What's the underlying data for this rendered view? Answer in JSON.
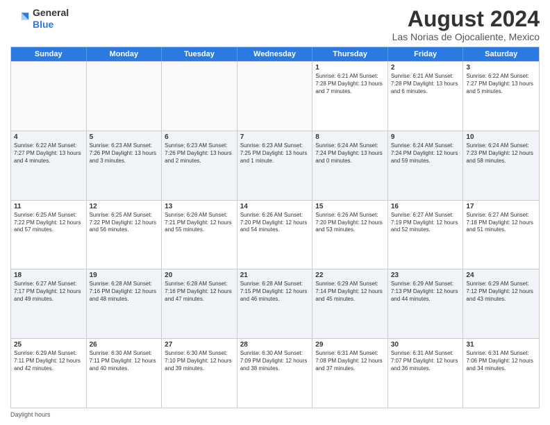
{
  "logo": {
    "line1": "General",
    "line2": "Blue"
  },
  "title": "August 2024",
  "subtitle": "Las Norias de Ojocaliente, Mexico",
  "days": [
    "Sunday",
    "Monday",
    "Tuesday",
    "Wednesday",
    "Thursday",
    "Friday",
    "Saturday"
  ],
  "weeks": [
    [
      {
        "day": "",
        "text": ""
      },
      {
        "day": "",
        "text": ""
      },
      {
        "day": "",
        "text": ""
      },
      {
        "day": "",
        "text": ""
      },
      {
        "day": "1",
        "text": "Sunrise: 6:21 AM\nSunset: 7:28 PM\nDaylight: 13 hours and 7 minutes."
      },
      {
        "day": "2",
        "text": "Sunrise: 6:21 AM\nSunset: 7:28 PM\nDaylight: 13 hours and 6 minutes."
      },
      {
        "day": "3",
        "text": "Sunrise: 6:22 AM\nSunset: 7:27 PM\nDaylight: 13 hours and 5 minutes."
      }
    ],
    [
      {
        "day": "4",
        "text": "Sunrise: 6:22 AM\nSunset: 7:27 PM\nDaylight: 13 hours and 4 minutes."
      },
      {
        "day": "5",
        "text": "Sunrise: 6:23 AM\nSunset: 7:26 PM\nDaylight: 13 hours and 3 minutes."
      },
      {
        "day": "6",
        "text": "Sunrise: 6:23 AM\nSunset: 7:26 PM\nDaylight: 13 hours and 2 minutes."
      },
      {
        "day": "7",
        "text": "Sunrise: 6:23 AM\nSunset: 7:25 PM\nDaylight: 13 hours and 1 minute."
      },
      {
        "day": "8",
        "text": "Sunrise: 6:24 AM\nSunset: 7:24 PM\nDaylight: 13 hours and 0 minutes."
      },
      {
        "day": "9",
        "text": "Sunrise: 6:24 AM\nSunset: 7:24 PM\nDaylight: 12 hours and 59 minutes."
      },
      {
        "day": "10",
        "text": "Sunrise: 6:24 AM\nSunset: 7:23 PM\nDaylight: 12 hours and 58 minutes."
      }
    ],
    [
      {
        "day": "11",
        "text": "Sunrise: 6:25 AM\nSunset: 7:22 PM\nDaylight: 12 hours and 57 minutes."
      },
      {
        "day": "12",
        "text": "Sunrise: 6:25 AM\nSunset: 7:22 PM\nDaylight: 12 hours and 56 minutes."
      },
      {
        "day": "13",
        "text": "Sunrise: 6:26 AM\nSunset: 7:21 PM\nDaylight: 12 hours and 55 minutes."
      },
      {
        "day": "14",
        "text": "Sunrise: 6:26 AM\nSunset: 7:20 PM\nDaylight: 12 hours and 54 minutes."
      },
      {
        "day": "15",
        "text": "Sunrise: 6:26 AM\nSunset: 7:20 PM\nDaylight: 12 hours and 53 minutes."
      },
      {
        "day": "16",
        "text": "Sunrise: 6:27 AM\nSunset: 7:19 PM\nDaylight: 12 hours and 52 minutes."
      },
      {
        "day": "17",
        "text": "Sunrise: 6:27 AM\nSunset: 7:18 PM\nDaylight: 12 hours and 51 minutes."
      }
    ],
    [
      {
        "day": "18",
        "text": "Sunrise: 6:27 AM\nSunset: 7:17 PM\nDaylight: 12 hours and 49 minutes."
      },
      {
        "day": "19",
        "text": "Sunrise: 6:28 AM\nSunset: 7:16 PM\nDaylight: 12 hours and 48 minutes."
      },
      {
        "day": "20",
        "text": "Sunrise: 6:28 AM\nSunset: 7:16 PM\nDaylight: 12 hours and 47 minutes."
      },
      {
        "day": "21",
        "text": "Sunrise: 6:28 AM\nSunset: 7:15 PM\nDaylight: 12 hours and 46 minutes."
      },
      {
        "day": "22",
        "text": "Sunrise: 6:29 AM\nSunset: 7:14 PM\nDaylight: 12 hours and 45 minutes."
      },
      {
        "day": "23",
        "text": "Sunrise: 6:29 AM\nSunset: 7:13 PM\nDaylight: 12 hours and 44 minutes."
      },
      {
        "day": "24",
        "text": "Sunrise: 6:29 AM\nSunset: 7:12 PM\nDaylight: 12 hours and 43 minutes."
      }
    ],
    [
      {
        "day": "25",
        "text": "Sunrise: 6:29 AM\nSunset: 7:11 PM\nDaylight: 12 hours and 42 minutes."
      },
      {
        "day": "26",
        "text": "Sunrise: 6:30 AM\nSunset: 7:11 PM\nDaylight: 12 hours and 40 minutes."
      },
      {
        "day": "27",
        "text": "Sunrise: 6:30 AM\nSunset: 7:10 PM\nDaylight: 12 hours and 39 minutes."
      },
      {
        "day": "28",
        "text": "Sunrise: 6:30 AM\nSunset: 7:09 PM\nDaylight: 12 hours and 38 minutes."
      },
      {
        "day": "29",
        "text": "Sunrise: 6:31 AM\nSunset: 7:08 PM\nDaylight: 12 hours and 37 minutes."
      },
      {
        "day": "30",
        "text": "Sunrise: 6:31 AM\nSunset: 7:07 PM\nDaylight: 12 hours and 36 minutes."
      },
      {
        "day": "31",
        "text": "Sunrise: 6:31 AM\nSunset: 7:06 PM\nDaylight: 12 hours and 34 minutes."
      }
    ]
  ],
  "footer": "Daylight hours"
}
